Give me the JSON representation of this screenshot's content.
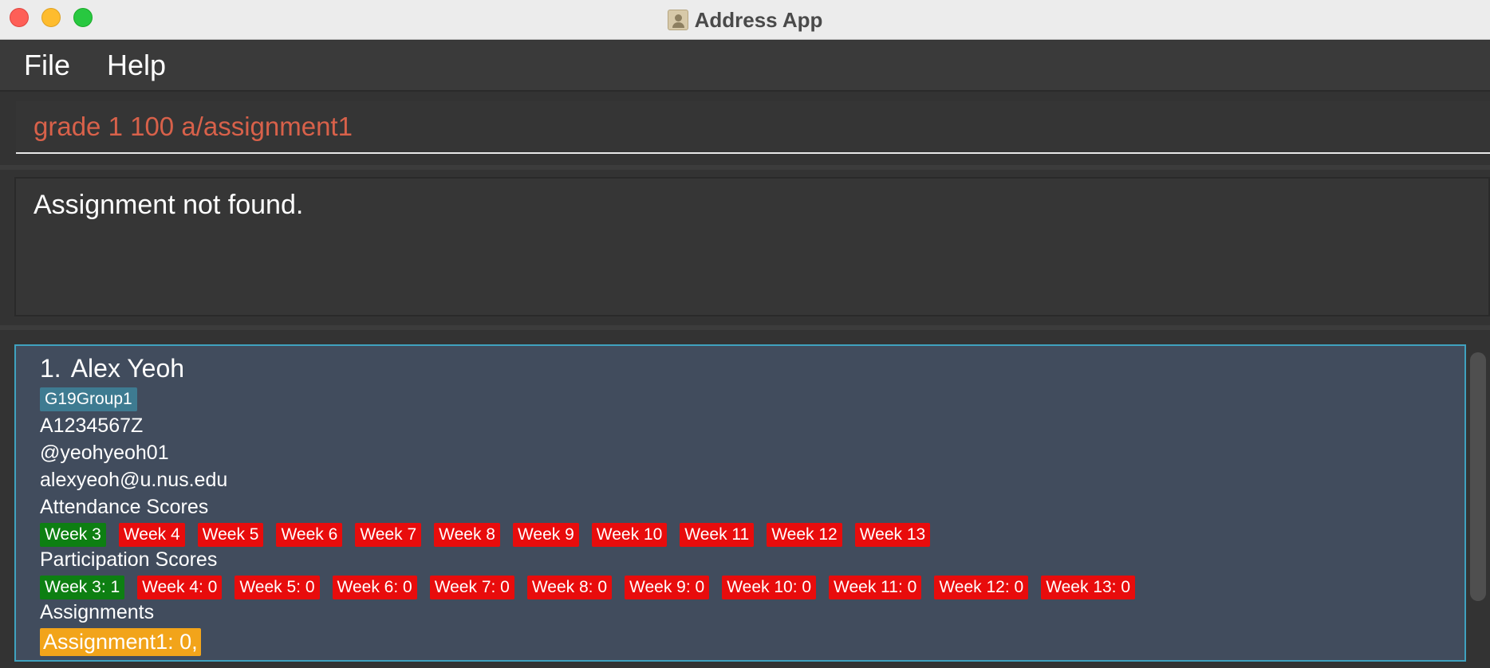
{
  "window": {
    "title": "Address App"
  },
  "menu": {
    "file": "File",
    "help": "Help"
  },
  "command": {
    "value": "grade 1 100 a/assignment1"
  },
  "result": {
    "message": "Assignment not found."
  },
  "person": {
    "index": "1.",
    "name": "Alex Yeoh",
    "group": "G19Group1",
    "matric": "A1234567Z",
    "telegram": "@yeohyeoh01",
    "email": "alexyeoh@u.nus.edu",
    "attendance_heading": "Attendance Scores",
    "attendance": [
      {
        "label": "Week 3",
        "status": "present"
      },
      {
        "label": "Week 4",
        "status": "absent"
      },
      {
        "label": "Week 5",
        "status": "absent"
      },
      {
        "label": "Week 6",
        "status": "absent"
      },
      {
        "label": "Week 7",
        "status": "absent"
      },
      {
        "label": "Week 8",
        "status": "absent"
      },
      {
        "label": "Week 9",
        "status": "absent"
      },
      {
        "label": "Week 10",
        "status": "absent"
      },
      {
        "label": "Week 11",
        "status": "absent"
      },
      {
        "label": "Week 12",
        "status": "absent"
      },
      {
        "label": "Week 13",
        "status": "absent"
      }
    ],
    "participation_heading": "Participation Scores",
    "participation": [
      {
        "label": "Week 3: 1",
        "status": "present"
      },
      {
        "label": "Week 4: 0",
        "status": "absent"
      },
      {
        "label": "Week 5: 0",
        "status": "absent"
      },
      {
        "label": "Week 6: 0",
        "status": "absent"
      },
      {
        "label": "Week 7: 0",
        "status": "absent"
      },
      {
        "label": "Week 8: 0",
        "status": "absent"
      },
      {
        "label": "Week 9: 0",
        "status": "absent"
      },
      {
        "label": "Week 10: 0",
        "status": "absent"
      },
      {
        "label": "Week 11: 0",
        "status": "absent"
      },
      {
        "label": "Week 12: 0",
        "status": "absent"
      },
      {
        "label": "Week 13: 0",
        "status": "absent"
      }
    ],
    "assignments_heading": "Assignments",
    "assignment": "Assignment1: 0,"
  },
  "colors": {
    "present": "#0d7f12",
    "absent": "#e80c0c",
    "assignment": "#f2a41a",
    "command_text": "#d8614a",
    "group_tag": "#3e7b91",
    "card_bg": "#414c5d",
    "card_border": "#3fa2bf"
  }
}
